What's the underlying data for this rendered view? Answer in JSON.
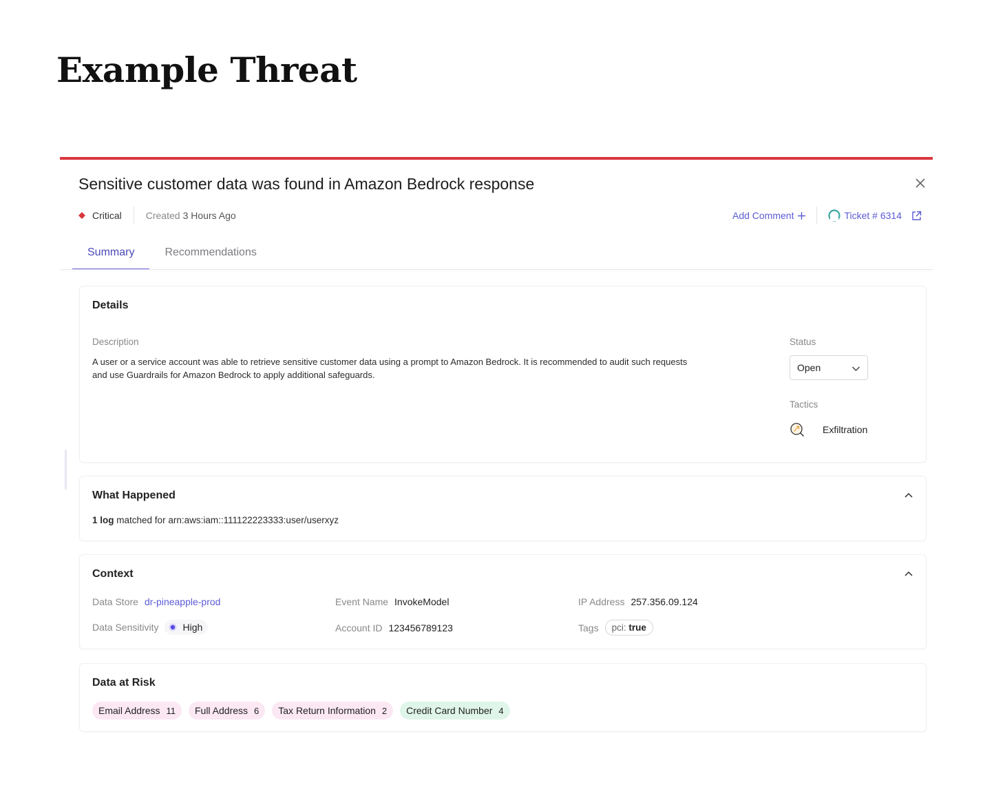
{
  "page": {
    "title": "Example Threat"
  },
  "threat": {
    "title": "Sensitive customer data was found in Amazon Bedrock response",
    "severity": "Critical",
    "created_label": "Created",
    "created_value": "3 Hours Ago",
    "add_comment_label": "Add Comment",
    "ticket_label": "Ticket # 6314"
  },
  "tabs": [
    {
      "label": "Summary",
      "active": true
    },
    {
      "label": "Recommendations",
      "active": false
    }
  ],
  "details": {
    "title": "Details",
    "description_label": "Description",
    "description": "A user or a service account was able to retrieve sensitive customer data using a prompt to Amazon Bedrock. It is recommended to audit such requests and use Guardrails for Amazon Bedrock to apply additional safeguards.",
    "status_label": "Status",
    "status_value": "Open",
    "tactics_label": "Tactics",
    "tactic": "Exfiltration"
  },
  "what_happened": {
    "title": "What Happened",
    "count": "1 log",
    "text": "matched for arn:aws:iam::111122223333:user/userxyz"
  },
  "context": {
    "title": "Context",
    "data_store_label": "Data Store",
    "data_store_value": "dr-pineapple-prod",
    "event_name_label": "Event Name",
    "event_name_value": "InvokeModel",
    "ip_label": "IP Address",
    "ip_value": "257.356.09.124",
    "sensitivity_label": "Data Sensitivity",
    "sensitivity_value": "High",
    "account_label": "Account ID",
    "account_value": "123456789123",
    "tags_label": "Tags",
    "tag_key": "pci:",
    "tag_value": "true"
  },
  "data_at_risk": {
    "title": "Data at Risk",
    "items": [
      {
        "label": "Email Address",
        "count": "11",
        "color": "pink"
      },
      {
        "label": "Full Address",
        "count": "6",
        "color": "pink"
      },
      {
        "label": "Tax Return Information",
        "count": "2",
        "color": "pink"
      },
      {
        "label": "Credit Card Number",
        "count": "4",
        "color": "green"
      }
    ]
  },
  "colors": {
    "accent": "#5b5bd6",
    "critical": "#d9363e",
    "risk_pink": "#fbe8f3",
    "risk_green": "#dff5ea"
  },
  "icons": [
    "critical-icon",
    "plus-icon",
    "ticket-icon",
    "external-link-icon",
    "close-icon",
    "chevron-down-icon",
    "chevron-up-icon",
    "exfiltration-icon",
    "sensitivity-dot-icon"
  ]
}
